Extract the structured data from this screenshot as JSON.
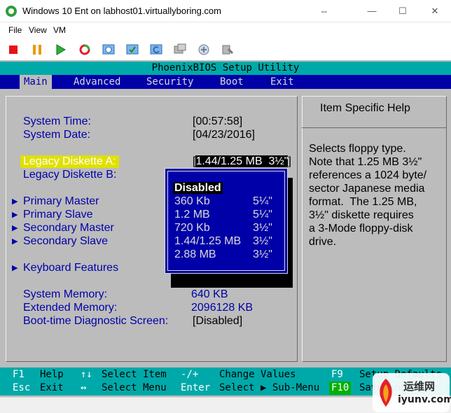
{
  "window": {
    "title": "Windows 10 Ent on labhost01.virtuallyboring.com",
    "controls": {
      "resize": "⇔",
      "minimize": "—",
      "maximize": "☐",
      "close": "✕"
    }
  },
  "menubar": {
    "items": [
      "File",
      "View",
      "VM"
    ]
  },
  "toolbar": {
    "icons": [
      "stop-icon",
      "pause-icon",
      "start-icon",
      "reset-icon",
      "ctrl-alt-del-icon",
      "checkpoint-icon",
      "revert-icon",
      "enhanced-session-icon",
      "share-icon",
      "settings-icon",
      "zoom-icon"
    ]
  },
  "bios": {
    "title": "PhoenixBIOS Setup Utility",
    "tabs": [
      "Main",
      "Advanced",
      "Security",
      "Boot",
      "Exit"
    ],
    "main": {
      "system_time_label": "System Time:",
      "system_time_value": "[00:57:58]",
      "system_date_label": "System Date:",
      "system_date_value": "[04/23/2016]",
      "legacy_a_label": "Legacy Diskette A:",
      "legacy_a_value": "[1.44/1.25 MB  3½\"]",
      "legacy_b_label": "Legacy Diskette B:",
      "submenus": [
        "Primary Master",
        "Primary Slave",
        "Secondary Master",
        "Secondary Slave"
      ],
      "keyboard_features": "Keyboard Features",
      "system_memory_label": "System Memory:",
      "system_memory_value": "640 KB",
      "extended_memory_label": "Extended Memory:",
      "extended_memory_value": "2096128 KB",
      "boot_diag_label": "Boot-time Diagnostic Screen:",
      "boot_diag_value": "[Disabled]",
      "arrow_glyph": "▶"
    },
    "popup": {
      "options": [
        {
          "label": "Disabled",
          "size": ""
        },
        {
          "label": "360 Kb",
          "size": "5¼\""
        },
        {
          "label": "1.2 MB",
          "size": "5¼\""
        },
        {
          "label": "720 Kb",
          "size": "3½\""
        },
        {
          "label": "1.44/1.25 MB",
          "size": "3½\""
        },
        {
          "label": "2.88 MB",
          "size": "3½\""
        }
      ],
      "selected": "Disabled"
    },
    "help": {
      "title": "Item Specific Help",
      "lines": [
        "Selects floppy type.",
        "Note that 1.25 MB 3½\"",
        "references a 1024 byte/",
        "sector Japanese media",
        "format.  The 1.25 MB,",
        "3½\" diskette requires",
        "a 3-Mode floppy-disk",
        "drive."
      ]
    },
    "footer": {
      "row1": [
        {
          "key": "F1",
          "desc": "Help"
        },
        {
          "key": "↑↓",
          "desc": "Select Item"
        },
        {
          "key": "-/+",
          "desc": "Change Values"
        },
        {
          "key": "F9",
          "desc": "Setup Defaults"
        }
      ],
      "row2": [
        {
          "key": "Esc",
          "desc": "Exit"
        },
        {
          "key": "↔",
          "desc": "Select Menu"
        },
        {
          "key": "Enter",
          "desc": "Select ▶ Sub-Menu"
        },
        {
          "key": "F10",
          "desc": "Save and Exit"
        }
      ]
    }
  },
  "watermark": {
    "brand": "运维网",
    "url": "iyunv.com"
  },
  "colors": {
    "bios_background": "#bcbcbc",
    "bios_blue": "#0000a8",
    "bios_cyan": "#00a9a9",
    "highlight_yellow": "#e0e000",
    "f10_green": "#00b000"
  }
}
